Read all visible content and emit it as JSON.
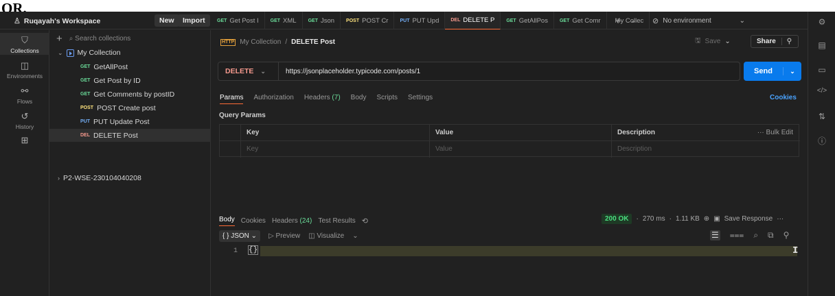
{
  "header_text": "OR.",
  "workspace": {
    "name": "Ruqayah's Workspace",
    "new_label": "New",
    "import_label": "Import"
  },
  "tabs": [
    {
      "method": "GET",
      "label": "Get Post I",
      "color": "#6bdd9a"
    },
    {
      "method": "GET",
      "label": "XML",
      "color": "#6bdd9a"
    },
    {
      "method": "GET",
      "label": "Json",
      "color": "#6bdd9a"
    },
    {
      "method": "POST",
      "label": "POST Cr",
      "color": "#ffe47e"
    },
    {
      "method": "PUT",
      "label": "PUT Upd",
      "color": "#74aef6"
    },
    {
      "method": "DEL",
      "label": "DELETE P",
      "color": "#f79a8e",
      "active": true
    },
    {
      "method": "GET",
      "label": "GetAllPos",
      "color": "#6bdd9a"
    },
    {
      "method": "GET",
      "label": "Get Comr",
      "color": "#6bdd9a"
    },
    {
      "method": "",
      "label": "My Collec",
      "color": "#a8a8a8"
    }
  ],
  "environment": {
    "label": "No environment"
  },
  "rail": [
    {
      "label": "Collections",
      "icon": "collections-icon",
      "glyph": "⛉",
      "active": true
    },
    {
      "label": "Environments",
      "icon": "environments-icon",
      "glyph": "◫"
    },
    {
      "label": "Flows",
      "icon": "flows-icon",
      "glyph": "⚯"
    },
    {
      "label": "History",
      "icon": "history-icon",
      "glyph": "↺"
    },
    {
      "label": "",
      "icon": "apps-icon",
      "glyph": "⊞"
    }
  ],
  "sidebar": {
    "search_placeholder": "Search collections",
    "collection": "My Collection",
    "requests": [
      {
        "method": "GET",
        "name": "GetAllPost",
        "color": "#6bdd9a"
      },
      {
        "method": "GET",
        "name": "Get Post by ID",
        "color": "#6bdd9a"
      },
      {
        "method": "GET",
        "name": "Get Comments by postID",
        "color": "#6bdd9a"
      },
      {
        "method": "POST",
        "name": "POST Create post",
        "color": "#ffe47e"
      },
      {
        "method": "PUT",
        "name": "PUT Update Post",
        "color": "#74aef6"
      },
      {
        "method": "DEL",
        "name": "DELETE Post",
        "color": "#f79a8e",
        "selected": true
      }
    ],
    "other_collection": "P2-WSE-230104040208"
  },
  "request": {
    "breadcrumb_parent": "My Collection",
    "breadcrumb_current": "DELETE Post",
    "save_label": "Save",
    "share_label": "Share",
    "method": "DELETE",
    "url": "https://jsonplaceholder.typicode.com/posts/1",
    "send_label": "Send",
    "tabs": [
      "Params",
      "Authorization",
      "Headers",
      "Body",
      "Scripts",
      "Settings"
    ],
    "headers_count": "(7)",
    "cookies_label": "Cookies",
    "query_params_label": "Query Params",
    "table_headers": [
      "Key",
      "Value",
      "Description"
    ],
    "bulk_edit": "Bulk Edit",
    "placeholders": [
      "Key",
      "Value",
      "Description"
    ]
  },
  "response": {
    "tabs": [
      "Body",
      "Cookies",
      "Headers",
      "Test Results"
    ],
    "headers_count": "(24)",
    "status": "200 OK",
    "time": "270 ms",
    "size": "1.11 KB",
    "save_response": "Save Response",
    "format": "{ } JSON",
    "preview": "Preview",
    "visualize": "Visualize",
    "line_number": "1",
    "code": "{}"
  }
}
